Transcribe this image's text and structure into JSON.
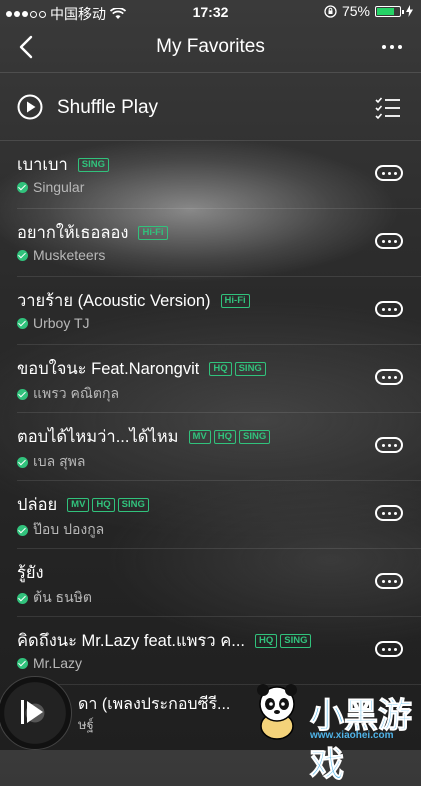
{
  "status": {
    "carrier": "中国移动",
    "time": "17:32",
    "battery": "75%",
    "battery_level": 0.75,
    "accent": "#25d366"
  },
  "nav": {
    "title": "My Favorites",
    "back_icon": "chevron-left-icon",
    "more_icon": "more-horizontal-icon"
  },
  "shuffle": {
    "label": "Shuffle Play",
    "icon": "play-circle-icon",
    "manage_icon": "list-checked-icon"
  },
  "songs": [
    {
      "title": "เบาเบา",
      "badges": [
        "SING"
      ],
      "artist": "Singular"
    },
    {
      "title": "อยากให้เธอลอง",
      "badges": [
        "Hi-Fi"
      ],
      "artist": "Musketeers"
    },
    {
      "title": "วายร้าย (Acoustic Version)",
      "badges": [
        "Hi-Fi"
      ],
      "artist": "Urboy TJ"
    },
    {
      "title": "ขอบใจนะ Feat.Narongvit",
      "badges": [
        "HQ",
        "SING"
      ],
      "artist": "แพรว คณิตกุล"
    },
    {
      "title": "ตอบได้ไหมว่า...ได้ไหม",
      "badges": [
        "MV",
        "HQ",
        "SING"
      ],
      "artist": "เบล สุพล"
    },
    {
      "title": "ปล่อย",
      "badges": [
        "MV",
        "HQ",
        "SING"
      ],
      "artist": "ป๊อบ ปองกูล"
    },
    {
      "title": "รู้ยัง",
      "badges": [],
      "artist": "ต้น ธนษิต"
    },
    {
      "title": "คิดถึงนะ Mr.Lazy feat.แพรว ค...",
      "badges": [
        "HQ",
        "SING"
      ],
      "artist": "Mr.Lazy"
    }
  ],
  "player": {
    "title": "ดา (เพลงประกอบซีรี...",
    "subtitle": "ษฐ์"
  },
  "watermark": {
    "text": "小黑游戏",
    "url": "www.xiaohei.com"
  },
  "colors": {
    "badge_green": "#31c27c",
    "watermark_blue": "#4fb3e8"
  }
}
